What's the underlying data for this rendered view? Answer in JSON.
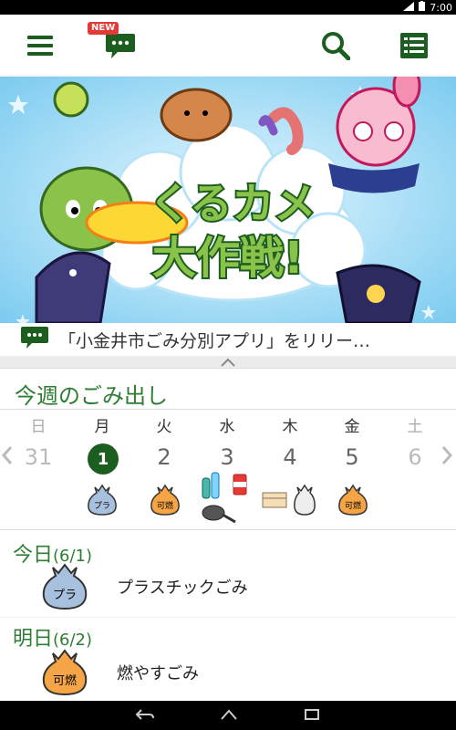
{
  "status_bar": {
    "time": "7:00",
    "signal": "3G"
  },
  "app_bar": {
    "new_badge": "NEW"
  },
  "banner": {
    "title_line1": "くるカメ",
    "title_line2": "大作戦!"
  },
  "notice": {
    "text": "「小金井市ごみ分別アプリ」をリリー…"
  },
  "week": {
    "title": "今週のごみ出し",
    "days": [
      {
        "dow": "日",
        "num": "31"
      },
      {
        "dow": "月",
        "num": "1"
      },
      {
        "dow": "火",
        "num": "2"
      },
      {
        "dow": "水",
        "num": "3"
      },
      {
        "dow": "木",
        "num": "4"
      },
      {
        "dow": "金",
        "num": "5"
      },
      {
        "dow": "土",
        "num": "6"
      }
    ],
    "bags": {
      "plastic": "プラ",
      "burnable": "可燃"
    }
  },
  "schedule": [
    {
      "day": "今日",
      "date": "(6/1)",
      "bag": "プラ",
      "label": "プラスチックごみ"
    },
    {
      "day": "明日",
      "date": "(6/2)",
      "bag": "可燃",
      "label": "燃やすごみ"
    }
  ],
  "colors": {
    "accent": "#1b5e20",
    "heading": "#2e7d32",
    "plastic_bag": "#a7c0dd",
    "burnable_bag": "#f5a545"
  }
}
